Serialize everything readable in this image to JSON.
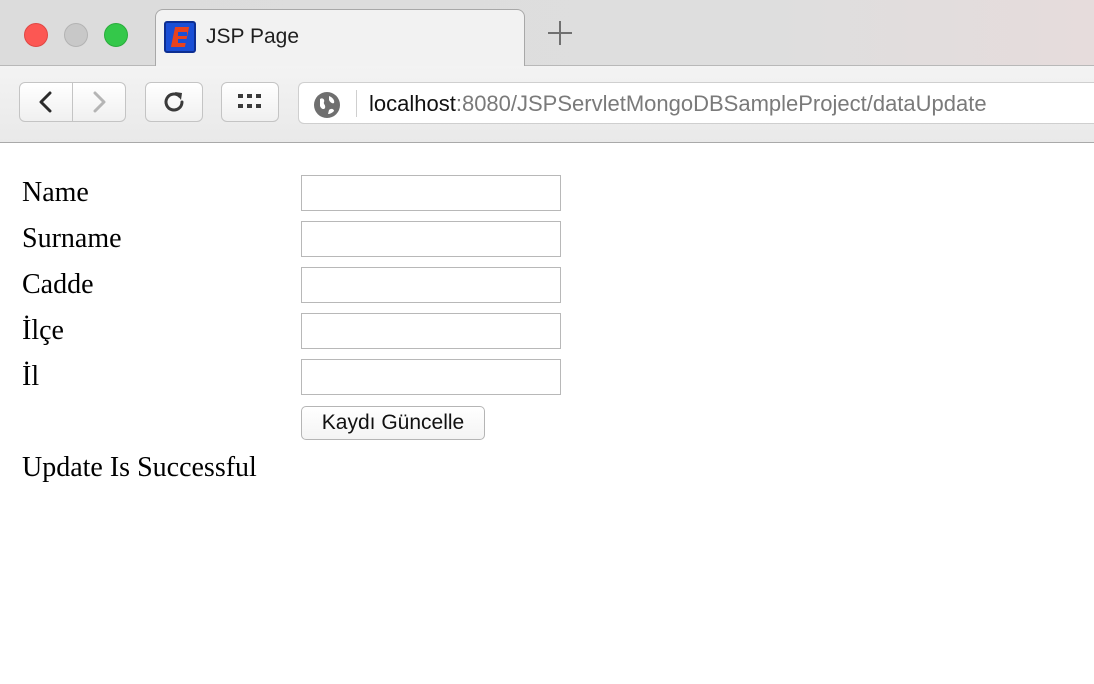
{
  "browser": {
    "tab": {
      "title": "JSP Page",
      "favicon": "jsp-app-icon"
    },
    "new_tab_icon": "plus-icon",
    "url": {
      "host": "localhost",
      "rest": ":8080/JSPServletMongoDBSampleProject/dataUpdate"
    },
    "icons": {
      "back": "chevron-left-icon",
      "forward": "chevron-right-icon",
      "reload": "reload-icon",
      "apps": "grid-icon",
      "site_info": "globe-icon"
    },
    "colors": {
      "close": "#fc5753",
      "minimize_disabled": "#c8c8c8",
      "zoom": "#34c84a"
    }
  },
  "form": {
    "fields": [
      {
        "label": "Name",
        "value": ""
      },
      {
        "label": "Surname",
        "value": ""
      },
      {
        "label": "Cadde",
        "value": ""
      },
      {
        "label": "İlçe",
        "value": ""
      },
      {
        "label": "İl",
        "value": ""
      }
    ],
    "submit_label": "Kaydı Güncelle"
  },
  "status_message": "Update Is Successful"
}
